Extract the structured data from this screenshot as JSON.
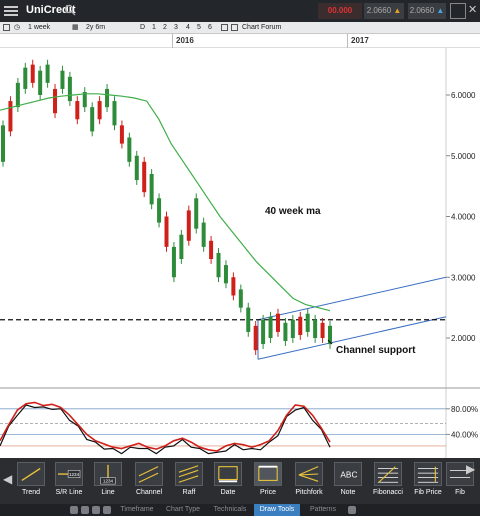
{
  "app": {
    "title": "UniCredit"
  },
  "prices": {
    "sell": "00.000",
    "quote1": "2.0660",
    "quote2": "2.0660"
  },
  "toolbar": {
    "interval": "1 week",
    "range": "2y 6m",
    "d": "D",
    "n1": "1",
    "n2": "2",
    "n3": "3",
    "n4": "4",
    "n5": "5",
    "n6": "6",
    "forum": "Chart Forum"
  },
  "years": [
    "2016",
    "2017"
  ],
  "chart_data": {
    "type": "candlestick",
    "y_ticks": [
      "6.0000",
      "5.0000",
      "4.0000",
      "3.0000",
      "2.0000"
    ],
    "ylim": [
      1.5,
      6.7
    ],
    "annotations": [
      "40 week ma",
      "Channel support"
    ],
    "dashed_level": 2.3,
    "ma_40": [
      5.75,
      5.8,
      5.85,
      5.9,
      5.95,
      5.98,
      6.0,
      6.02,
      6.02,
      6.0,
      5.98,
      5.95,
      5.9,
      5.6,
      5.2,
      4.9,
      4.6,
      4.3,
      4.0,
      3.75,
      3.5,
      3.25,
      3.05,
      2.85,
      2.65,
      2.55,
      2.5,
      2.45
    ],
    "candles": [
      [
        4.9,
        5.5
      ],
      [
        5.4,
        5.9
      ],
      [
        5.8,
        6.2
      ],
      [
        6.1,
        6.45
      ],
      [
        6.2,
        6.5
      ],
      [
        6.0,
        6.4
      ],
      [
        6.2,
        6.5
      ],
      [
        5.7,
        6.1
      ],
      [
        6.1,
        6.4
      ],
      [
        5.9,
        6.3
      ],
      [
        5.6,
        5.9
      ],
      [
        5.8,
        6.05
      ],
      [
        5.4,
        5.8
      ],
      [
        5.6,
        5.9
      ],
      [
        5.8,
        6.1
      ],
      [
        5.5,
        5.9
      ],
      [
        5.2,
        5.5
      ],
      [
        4.9,
        5.3
      ],
      [
        4.6,
        5.0
      ],
      [
        4.4,
        4.9
      ],
      [
        4.2,
        4.7
      ],
      [
        3.9,
        4.3
      ],
      [
        3.5,
        4.0
      ],
      [
        3.0,
        3.5
      ],
      [
        3.3,
        3.7
      ],
      [
        3.6,
        4.1
      ],
      [
        3.8,
        4.3
      ],
      [
        3.5,
        3.9
      ],
      [
        3.3,
        3.6
      ],
      [
        3.0,
        3.4
      ],
      [
        2.9,
        3.2
      ],
      [
        2.7,
        3.0
      ],
      [
        2.5,
        2.8
      ],
      [
        2.1,
        2.5
      ],
      [
        1.8,
        2.2
      ],
      [
        1.9,
        2.3
      ],
      [
        2.0,
        2.35
      ],
      [
        2.1,
        2.4
      ],
      [
        1.95,
        2.25
      ],
      [
        2.0,
        2.3
      ],
      [
        2.05,
        2.35
      ],
      [
        2.1,
        2.4
      ],
      [
        2.0,
        2.3
      ],
      [
        2.0,
        2.25
      ],
      [
        1.9,
        2.2
      ]
    ],
    "oscillator": {
      "y_ticks": [
        "80.00%",
        "40.00%"
      ],
      "levels": [
        80,
        40
      ]
    }
  },
  "tools": [
    {
      "label": "Trend"
    },
    {
      "label": "S/R Line"
    },
    {
      "label": "Line"
    },
    {
      "label": "Channel"
    },
    {
      "label": "Raff"
    },
    {
      "label": "Date"
    },
    {
      "label": "Price"
    },
    {
      "label": "Pitchfork"
    },
    {
      "label": "Note"
    },
    {
      "label": "Fibonacci"
    },
    {
      "label": "Fib Price"
    },
    {
      "label": "Fib"
    }
  ],
  "tools_icons": {
    "sr_value": "1234",
    "line_value": "1234",
    "note_text": "ABC"
  },
  "tabs": [
    {
      "label": "Timeframe"
    },
    {
      "label": "Chart Type"
    },
    {
      "label": "Technicals"
    },
    {
      "label": "Draw Tools"
    },
    {
      "label": "Patterns"
    }
  ]
}
